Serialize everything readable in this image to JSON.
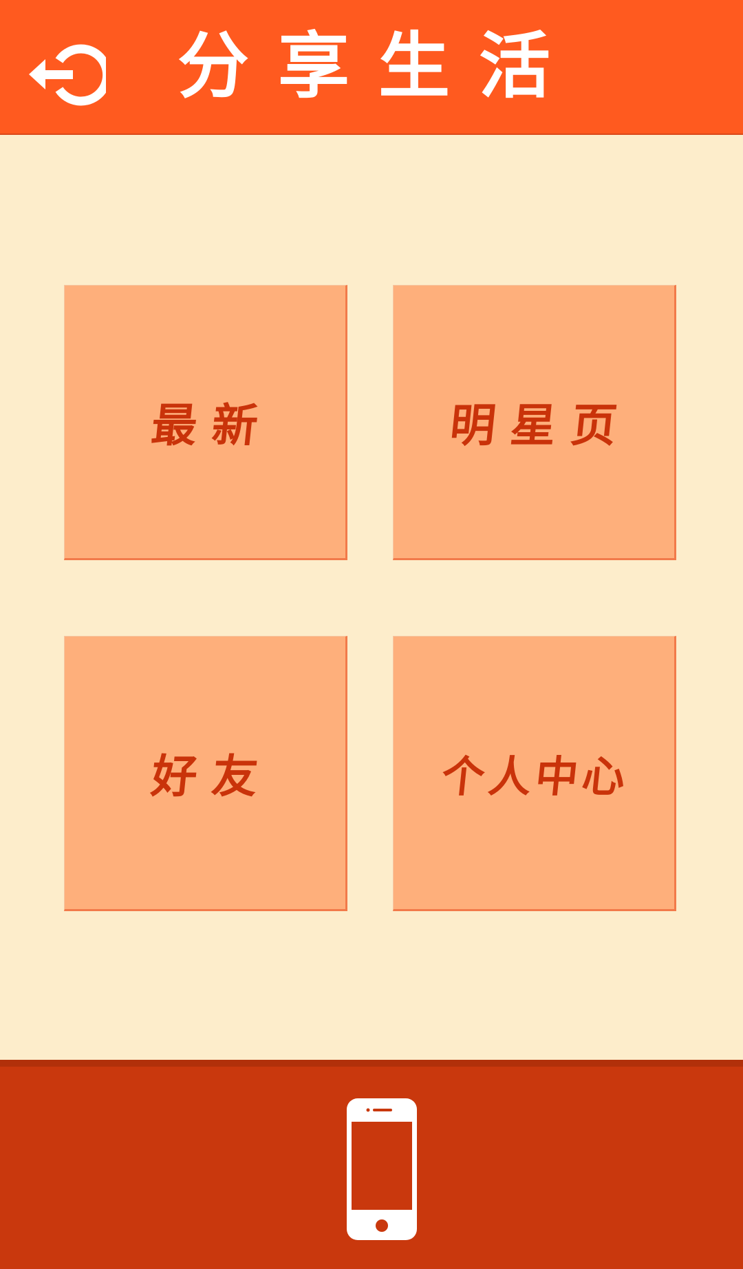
{
  "header": {
    "title": "分享生活",
    "back_icon": "back-arrow-circle-icon",
    "background": "#FF5A1F"
  },
  "tiles": [
    {
      "label": "最新"
    },
    {
      "label": "明星页"
    },
    {
      "label": "好友"
    },
    {
      "label": "个人中心"
    }
  ],
  "bottom_bar": {
    "icon": "smartphone-icon",
    "background": "#C9380D"
  },
  "colors": {
    "page_background": "#FDEDCB",
    "tile_background": "#FEAF7B",
    "tile_text": "#C9330A",
    "header_text": "#FFFFFF"
  }
}
